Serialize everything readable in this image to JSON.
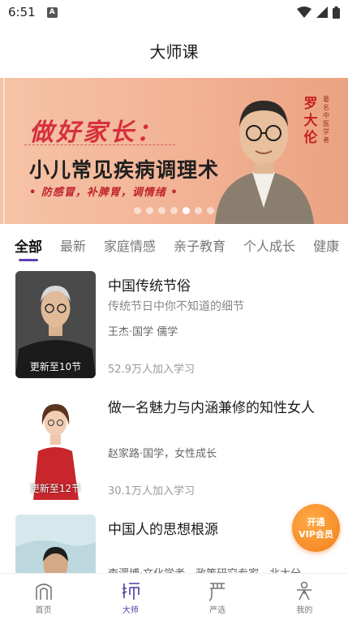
{
  "status_bar": {
    "time": "6:51",
    "notif_glyph": "A"
  },
  "header": {
    "title": "大师课"
  },
  "banner": {
    "headline1": "做好家长：",
    "headline2": "小儿常见疾病调理术",
    "slogan": "• 防感冒，补脾胃，调情绪 •",
    "name": "罗大伦",
    "person_title": "著名中医学者",
    "dot_count": 7,
    "active_dot": 4
  },
  "tabs": [
    {
      "label": "全部",
      "active": true
    },
    {
      "label": "最新"
    },
    {
      "label": "家庭情感"
    },
    {
      "label": "亲子教育"
    },
    {
      "label": "个人成长"
    },
    {
      "label": "健康"
    }
  ],
  "courses": [
    {
      "title": "中国传统节俗",
      "subtitle": "传统节日中你不知道的细节",
      "author": "王杰·国学 儒学",
      "learners": "52.9万人加入学习",
      "badge": "更新至10节"
    },
    {
      "title": "做一名魅力与内涵兼修的知性女人",
      "subtitle": "",
      "author": "赵家路·国学，女性成长",
      "learners": "30.1万人加入学习",
      "badge": "更新至12节"
    },
    {
      "title": "中国人的思想根源",
      "subtitle": "",
      "author": "李渭博·文化学者，政策研究专家，北大分",
      "learners": "",
      "badge": ""
    }
  ],
  "vip": {
    "line1": "开通",
    "line2": "VIP会员"
  },
  "nav": [
    {
      "label": "首页",
      "icon": "home-arch-icon"
    },
    {
      "label": "大师",
      "icon": "master-icon",
      "active": true
    },
    {
      "label": "严选",
      "icon": "select-icon"
    },
    {
      "label": "我的",
      "icon": "profile-icon"
    }
  ],
  "colors": {
    "accent": "#5e40b8",
    "vip": "#f27f1c",
    "banner_red": "#d6303c"
  }
}
